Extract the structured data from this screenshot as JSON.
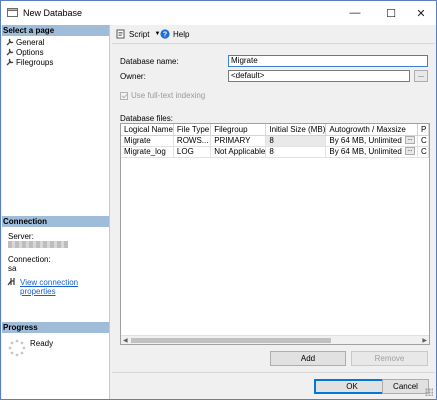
{
  "window": {
    "title": "New Database",
    "minimize_glyph": "—",
    "maximize_glyph": "☐",
    "close_glyph": "✕"
  },
  "sidebar": {
    "select_page_header": "Select a page",
    "pages": [
      {
        "label": "General",
        "icon": "wrench-icon"
      },
      {
        "label": "Options",
        "icon": "wrench-icon"
      },
      {
        "label": "Filegroups",
        "icon": "wrench-icon"
      }
    ],
    "connection_header": "Connection",
    "server_label": "Server:",
    "connection_label": "Connection:",
    "connection_value": "sa",
    "view_connection_link": "View connection properties",
    "progress_header": "Progress",
    "progress_status": "Ready"
  },
  "toolbar": {
    "script_label": "Script",
    "help_label": "Help"
  },
  "form": {
    "database_name_label": "Database name:",
    "database_name_value": "Migrate",
    "owner_label": "Owner:",
    "owner_value": "<default>",
    "browse_glyph": "...",
    "fulltext_label": "Use full-text indexing",
    "fulltext_checked": true,
    "database_files_label": "Database files:"
  },
  "files_grid": {
    "columns": [
      "Logical Name",
      "File Type",
      "Filegroup",
      "Initial Size (MB)",
      "Autogrowth / Maxsize",
      "P"
    ],
    "rows": [
      [
        "Migrate",
        "ROWS...",
        "PRIMARY",
        "8",
        "By 64 MB, Unlimited",
        "C"
      ],
      [
        "Migrate_log",
        "LOG",
        "Not Applicable",
        "8",
        "By 64 MB, Unlimited",
        "C"
      ]
    ]
  },
  "buttons": {
    "add": "Add",
    "remove": "Remove",
    "ok": "OK",
    "cancel": "Cancel"
  },
  "colors": {
    "section_header": "#9fbcd9",
    "link": "#1a5fd0",
    "accent": "#0078d7"
  }
}
